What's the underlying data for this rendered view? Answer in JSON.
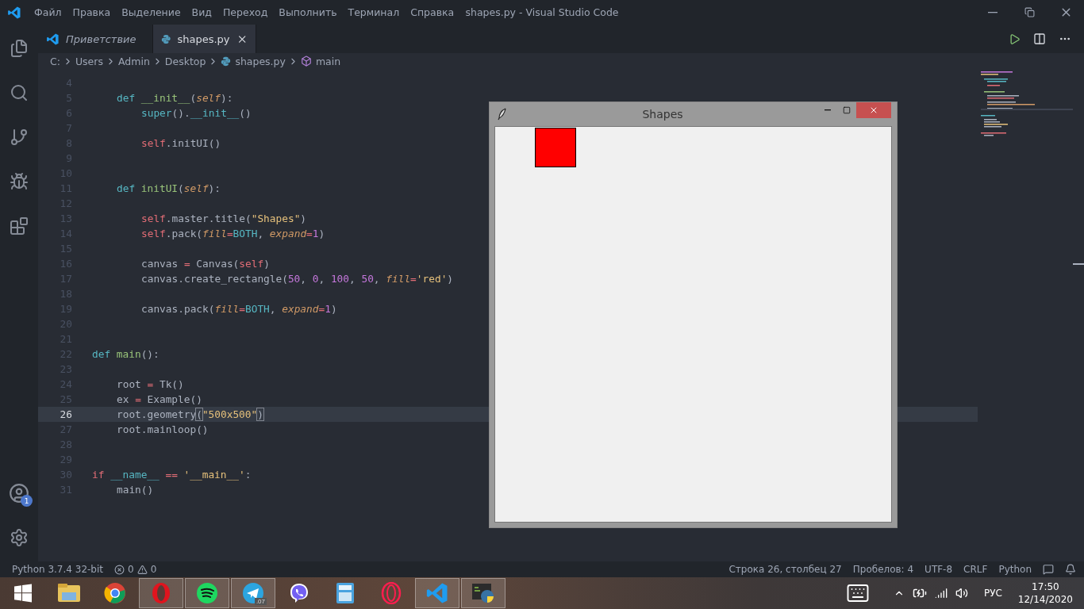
{
  "window": {
    "title": "shapes.py - Visual Studio Code"
  },
  "menu": [
    "Файл",
    "Правка",
    "Выделение",
    "Вид",
    "Переход",
    "Выполнить",
    "Терминал",
    "Справка"
  ],
  "activity_bar": {
    "account_badge": "1"
  },
  "tabs": [
    {
      "label": "Приветствие",
      "kind": "welcome",
      "selected": false
    },
    {
      "label": "shapes.py",
      "kind": "python",
      "selected": true
    }
  ],
  "breadcrumb": [
    {
      "label": "C:",
      "kind": "folder"
    },
    {
      "label": "Users",
      "kind": "folder"
    },
    {
      "label": "Admin",
      "kind": "folder"
    },
    {
      "label": "Desktop",
      "kind": "folder"
    },
    {
      "label": "shapes.py",
      "kind": "file"
    },
    {
      "label": "main",
      "kind": "symbol"
    }
  ],
  "code": [
    {
      "number": "4",
      "current": false
    },
    {
      "number": "5",
      "current": false,
      "kind": "nested",
      "tokens": [
        {
          "kind": "kw",
          "text": "def"
        },
        {
          "kind": "fn",
          "text": " __init__"
        },
        {
          "kind": "plain",
          "text": "("
        },
        {
          "kind": "param",
          "text": "self"
        },
        {
          "kind": "plain",
          "text": "):"
        }
      ]
    },
    {
      "number": "6",
      "current": false,
      "kind": "deep",
      "tokens": [
        {
          "kind": "builtin",
          "text": "super"
        },
        {
          "kind": "plain",
          "text": "()."
        },
        {
          "kind": "builtin",
          "text": "__init__"
        },
        {
          "kind": "plain",
          "text": "()"
        }
      ]
    },
    {
      "number": "7",
      "current": false
    },
    {
      "number": "8",
      "current": false,
      "kind": "deep",
      "tokens": [
        {
          "kind": "self",
          "text": "self"
        },
        {
          "kind": "plain",
          "text": ".initUI()"
        }
      ]
    },
    {
      "number": "9",
      "current": false
    },
    {
      "number": "10",
      "current": false
    },
    {
      "number": "11",
      "current": false,
      "kind": "nested",
      "tokens": [
        {
          "kind": "kw",
          "text": "def"
        },
        {
          "kind": "fn",
          "text": " initUI"
        },
        {
          "kind": "plain",
          "text": "("
        },
        {
          "kind": "param",
          "text": "self"
        },
        {
          "kind": "plain",
          "text": "):"
        }
      ]
    },
    {
      "number": "12",
      "current": false
    },
    {
      "number": "13",
      "current": false,
      "kind": "deep",
      "tokens": [
        {
          "kind": "self",
          "text": "self"
        },
        {
          "kind": "plain",
          "text": ".master.title("
        },
        {
          "kind": "str",
          "text": "\"Shapes\""
        },
        {
          "kind": "plain",
          "text": ")"
        }
      ]
    },
    {
      "number": "14",
      "current": false,
      "kind": "deep",
      "tokens": [
        {
          "kind": "self",
          "text": "self"
        },
        {
          "kind": "plain",
          "text": ".pack("
        },
        {
          "kind": "param",
          "text": "fill"
        },
        {
          "kind": "op",
          "text": "="
        },
        {
          "kind": "builtin",
          "text": "BOTH"
        },
        {
          "kind": "plain",
          "text": ", "
        },
        {
          "kind": "param",
          "text": "expand"
        },
        {
          "kind": "op",
          "text": "="
        },
        {
          "kind": "num",
          "text": "1"
        },
        {
          "kind": "plain",
          "text": ")"
        }
      ]
    },
    {
      "number": "15",
      "current": false
    },
    {
      "number": "16",
      "current": false,
      "kind": "deep",
      "tokens": [
        {
          "kind": "plain",
          "text": "canvas "
        },
        {
          "kind": "op",
          "text": "="
        },
        {
          "kind": "plain",
          "text": " Canvas("
        },
        {
          "kind": "self",
          "text": "self"
        },
        {
          "kind": "plain",
          "text": ")"
        }
      ]
    },
    {
      "number": "17",
      "current": false,
      "kind": "deep",
      "tokens": [
        {
          "kind": "plain",
          "text": "canvas.create_rectangle("
        },
        {
          "kind": "num",
          "text": "50"
        },
        {
          "kind": "plain",
          "text": ", "
        },
        {
          "kind": "num",
          "text": "0"
        },
        {
          "kind": "plain",
          "text": ", "
        },
        {
          "kind": "num",
          "text": "100"
        },
        {
          "kind": "plain",
          "text": ", "
        },
        {
          "kind": "num",
          "text": "50"
        },
        {
          "kind": "plain",
          "text": ", "
        },
        {
          "kind": "param",
          "text": "fill"
        },
        {
          "kind": "op",
          "text": "="
        },
        {
          "kind": "str",
          "text": "'red'"
        },
        {
          "kind": "plain",
          "text": ")"
        }
      ]
    },
    {
      "number": "18",
      "current": false
    },
    {
      "number": "19",
      "current": false,
      "kind": "deep",
      "tokens": [
        {
          "kind": "plain",
          "text": "canvas.pack("
        },
        {
          "kind": "param",
          "text": "fill"
        },
        {
          "kind": "op",
          "text": "="
        },
        {
          "kind": "builtin",
          "text": "BOTH"
        },
        {
          "kind": "plain",
          "text": ", "
        },
        {
          "kind": "param",
          "text": "expand"
        },
        {
          "kind": "op",
          "text": "="
        },
        {
          "kind": "num",
          "text": "1"
        },
        {
          "kind": "plain",
          "text": ")"
        }
      ]
    },
    {
      "number": "20",
      "current": false
    },
    {
      "number": "21",
      "current": false
    },
    {
      "number": "22",
      "current": false,
      "kind": "flush",
      "tokens": [
        {
          "kind": "kw",
          "text": "def"
        },
        {
          "kind": "fn",
          "text": " main"
        },
        {
          "kind": "plain",
          "text": "():"
        }
      ]
    },
    {
      "number": "23",
      "current": false
    },
    {
      "number": "24",
      "current": false,
      "kind": "nested",
      "tokens": [
        {
          "kind": "plain",
          "text": "root "
        },
        {
          "kind": "op",
          "text": "="
        },
        {
          "kind": "plain",
          "text": " Tk()"
        }
      ]
    },
    {
      "number": "25",
      "current": false,
      "kind": "nested",
      "tokens": [
        {
          "kind": "plain",
          "text": "ex "
        },
        {
          "kind": "op",
          "text": "="
        },
        {
          "kind": "plain",
          "text": " Example()"
        }
      ]
    },
    {
      "number": "26",
      "current": true,
      "kind": "nested",
      "tokens": [
        {
          "kind": "plain",
          "text": "root.geometry"
        },
        {
          "kind": "bracket",
          "text": "("
        },
        {
          "kind": "str",
          "text": "\"500x500\""
        },
        {
          "kind": "bracket",
          "text": ")"
        }
      ]
    },
    {
      "number": "27",
      "current": false,
      "kind": "nested",
      "tokens": [
        {
          "kind": "plain",
          "text": "root.mainloop()"
        }
      ]
    },
    {
      "number": "28",
      "current": false
    },
    {
      "number": "29",
      "current": false
    },
    {
      "number": "30",
      "current": false,
      "kind": "flush",
      "tokens": [
        {
          "kind": "ctrl",
          "text": "if"
        },
        {
          "kind": "builtin",
          "text": " __name__"
        },
        {
          "kind": "op",
          "text": " =="
        },
        {
          "kind": "str",
          "text": " '__main__'"
        },
        {
          "kind": "plain",
          "text": ":"
        }
      ]
    },
    {
      "number": "31",
      "current": false,
      "kind": "nested",
      "tokens": [
        {
          "kind": "plain",
          "text": "main()"
        }
      ]
    }
  ],
  "tk_window": {
    "title": "Shapes"
  },
  "status_bar": {
    "interpreter": "Python 3.7.4 32-bit",
    "errors": "0",
    "warnings": "0",
    "position": "Строка 26, столбец 27",
    "indent": "Пробелов: 4",
    "encoding": "UTF-8",
    "eol": "CRLF",
    "language": "Python"
  },
  "taskbar": {
    "apps": [
      {
        "kind": "folder",
        "open": false
      },
      {
        "kind": "globe",
        "open": false
      },
      {
        "kind": "redring",
        "open": true
      },
      {
        "kind": "green",
        "open": true
      },
      {
        "kind": "plane",
        "open": true,
        "badge": ".07"
      },
      {
        "kind": "phone",
        "open": false
      },
      {
        "kind": "calc",
        "open": false
      },
      {
        "kind": "ring",
        "open": false
      },
      {
        "kind": "ribbon",
        "open": true
      },
      {
        "kind": "idle",
        "open": true
      }
    ],
    "language": "РУС",
    "time": "17:50",
    "date": "12/14/2020"
  }
}
